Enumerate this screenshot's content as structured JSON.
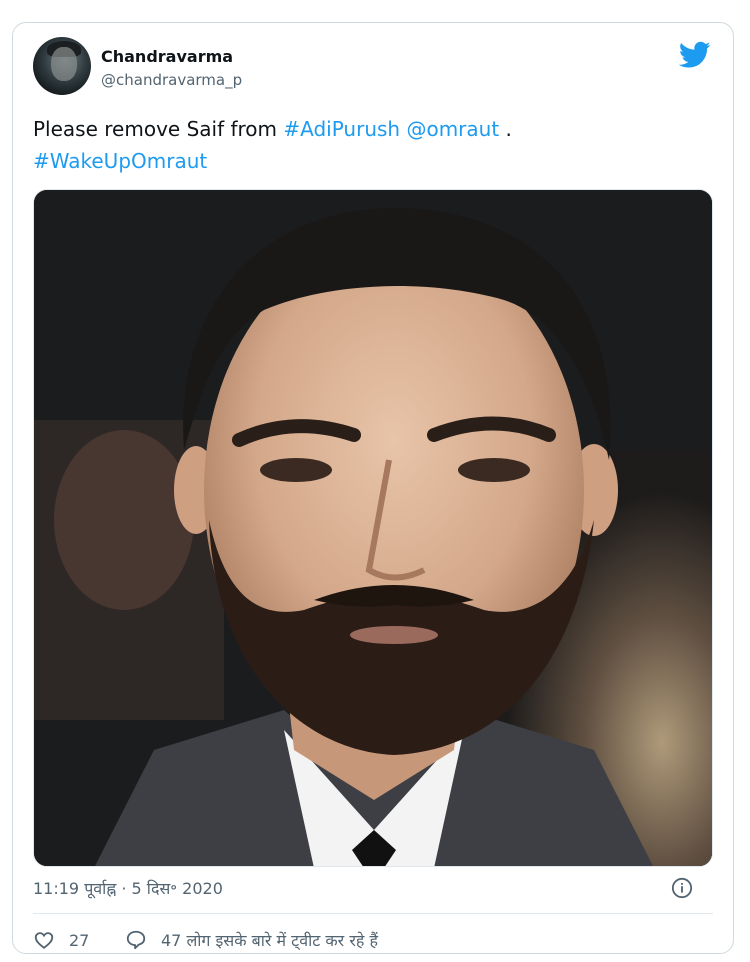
{
  "tweet": {
    "author_name": "Chandravarma",
    "author_handle": "@chandravarma_p",
    "text_parts": {
      "intro": "Please remove Saif from ",
      "hashtag1": "#AdiPurush",
      "space": " ",
      "mention": "@omraut",
      "dot": " .",
      "hashtag2": "#WakeUpOmraut"
    },
    "timestamp": "11:19 पूर्वाह्न · 5 दिस॰ 2020",
    "likes_count": "27",
    "people_tweeting": "47 लोग इसके बारे में ट्वीट कर रहे हैं"
  },
  "icons": {
    "platform": "twitter-bird-icon",
    "info": "info-icon",
    "like": "heart-icon",
    "reply": "speech-bubble-icon"
  },
  "colors": {
    "link": "#1d9bf0",
    "text": "#0f1419",
    "muted": "#536471",
    "border": "#cfd9de"
  }
}
